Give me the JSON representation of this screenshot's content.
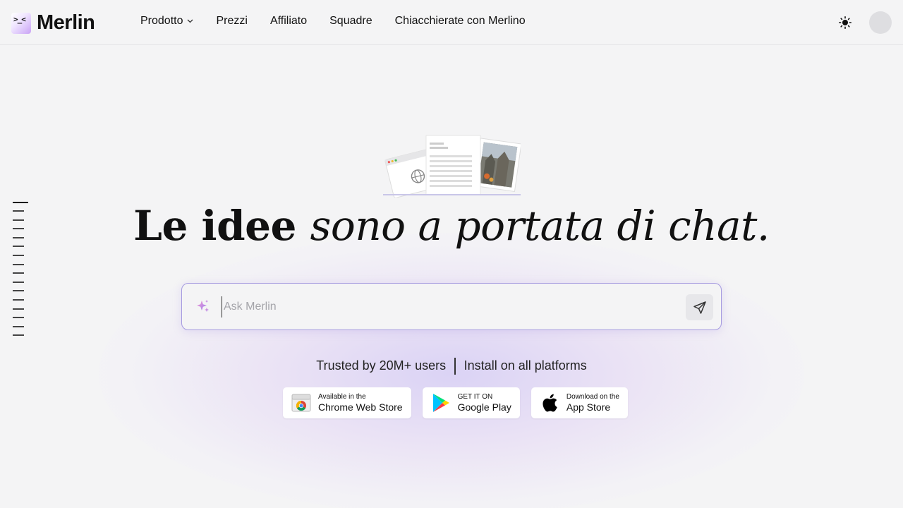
{
  "header": {
    "brand": "Merlin",
    "logo_face": ">_<",
    "nav": [
      {
        "label": "Prodotto",
        "has_dropdown": true
      },
      {
        "label": "Prezzi",
        "has_dropdown": false
      },
      {
        "label": "Affiliato",
        "has_dropdown": false
      },
      {
        "label": "Squadre",
        "has_dropdown": false
      },
      {
        "label": "Chiacchierate con Merlino",
        "has_dropdown": false
      }
    ],
    "theme_icon": "sun-icon"
  },
  "hero": {
    "title_bold": "Le idee",
    "title_italic": "sono a portata di chat."
  },
  "chat": {
    "placeholder": "Ask Merlin",
    "value": ""
  },
  "trust": {
    "users": "Trusted by 20M+ users",
    "install": "Install on all platforms"
  },
  "stores": [
    {
      "small": "Available in the",
      "big": "Chrome Web Store",
      "icon": "chrome-web-store-icon"
    },
    {
      "small": "GET IT ON",
      "big": "Google Play",
      "icon": "google-play-icon"
    },
    {
      "small": "Download on the",
      "big": "App Store",
      "icon": "apple-icon"
    }
  ],
  "colors": {
    "accent_border": "#a69be0",
    "background": "#f4f4f5"
  }
}
